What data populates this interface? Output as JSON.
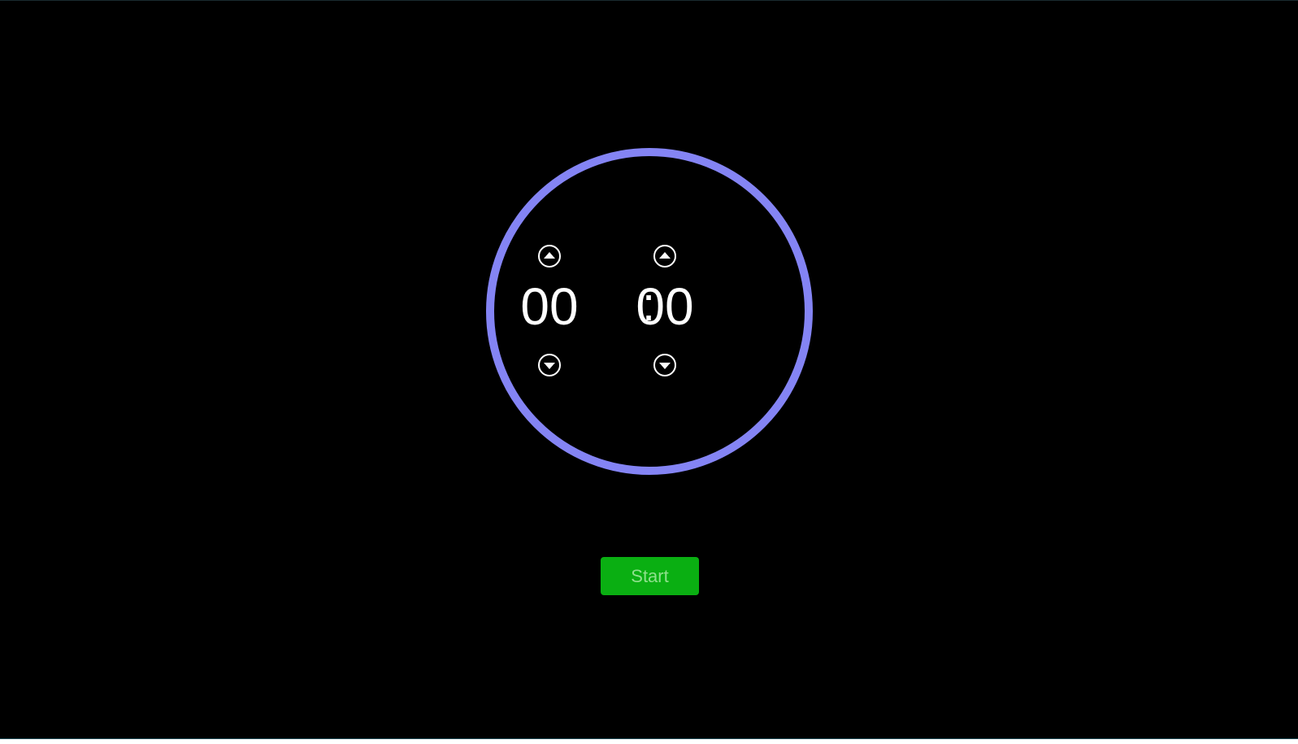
{
  "timer": {
    "minutes": "00",
    "separator": ":",
    "seconds": "00"
  },
  "controls": {
    "start_label": "Start",
    "minutes_up_icon": "triangle-up-circle-icon",
    "minutes_down_icon": "triangle-down-circle-icon",
    "seconds_up_icon": "triangle-up-circle-icon",
    "seconds_down_icon": "triangle-down-circle-icon"
  },
  "colors": {
    "background": "#000000",
    "ring": "#8484f4",
    "start_button": "#0aaf12",
    "start_text": "#8ee08c",
    "digits": "#ffffff"
  }
}
